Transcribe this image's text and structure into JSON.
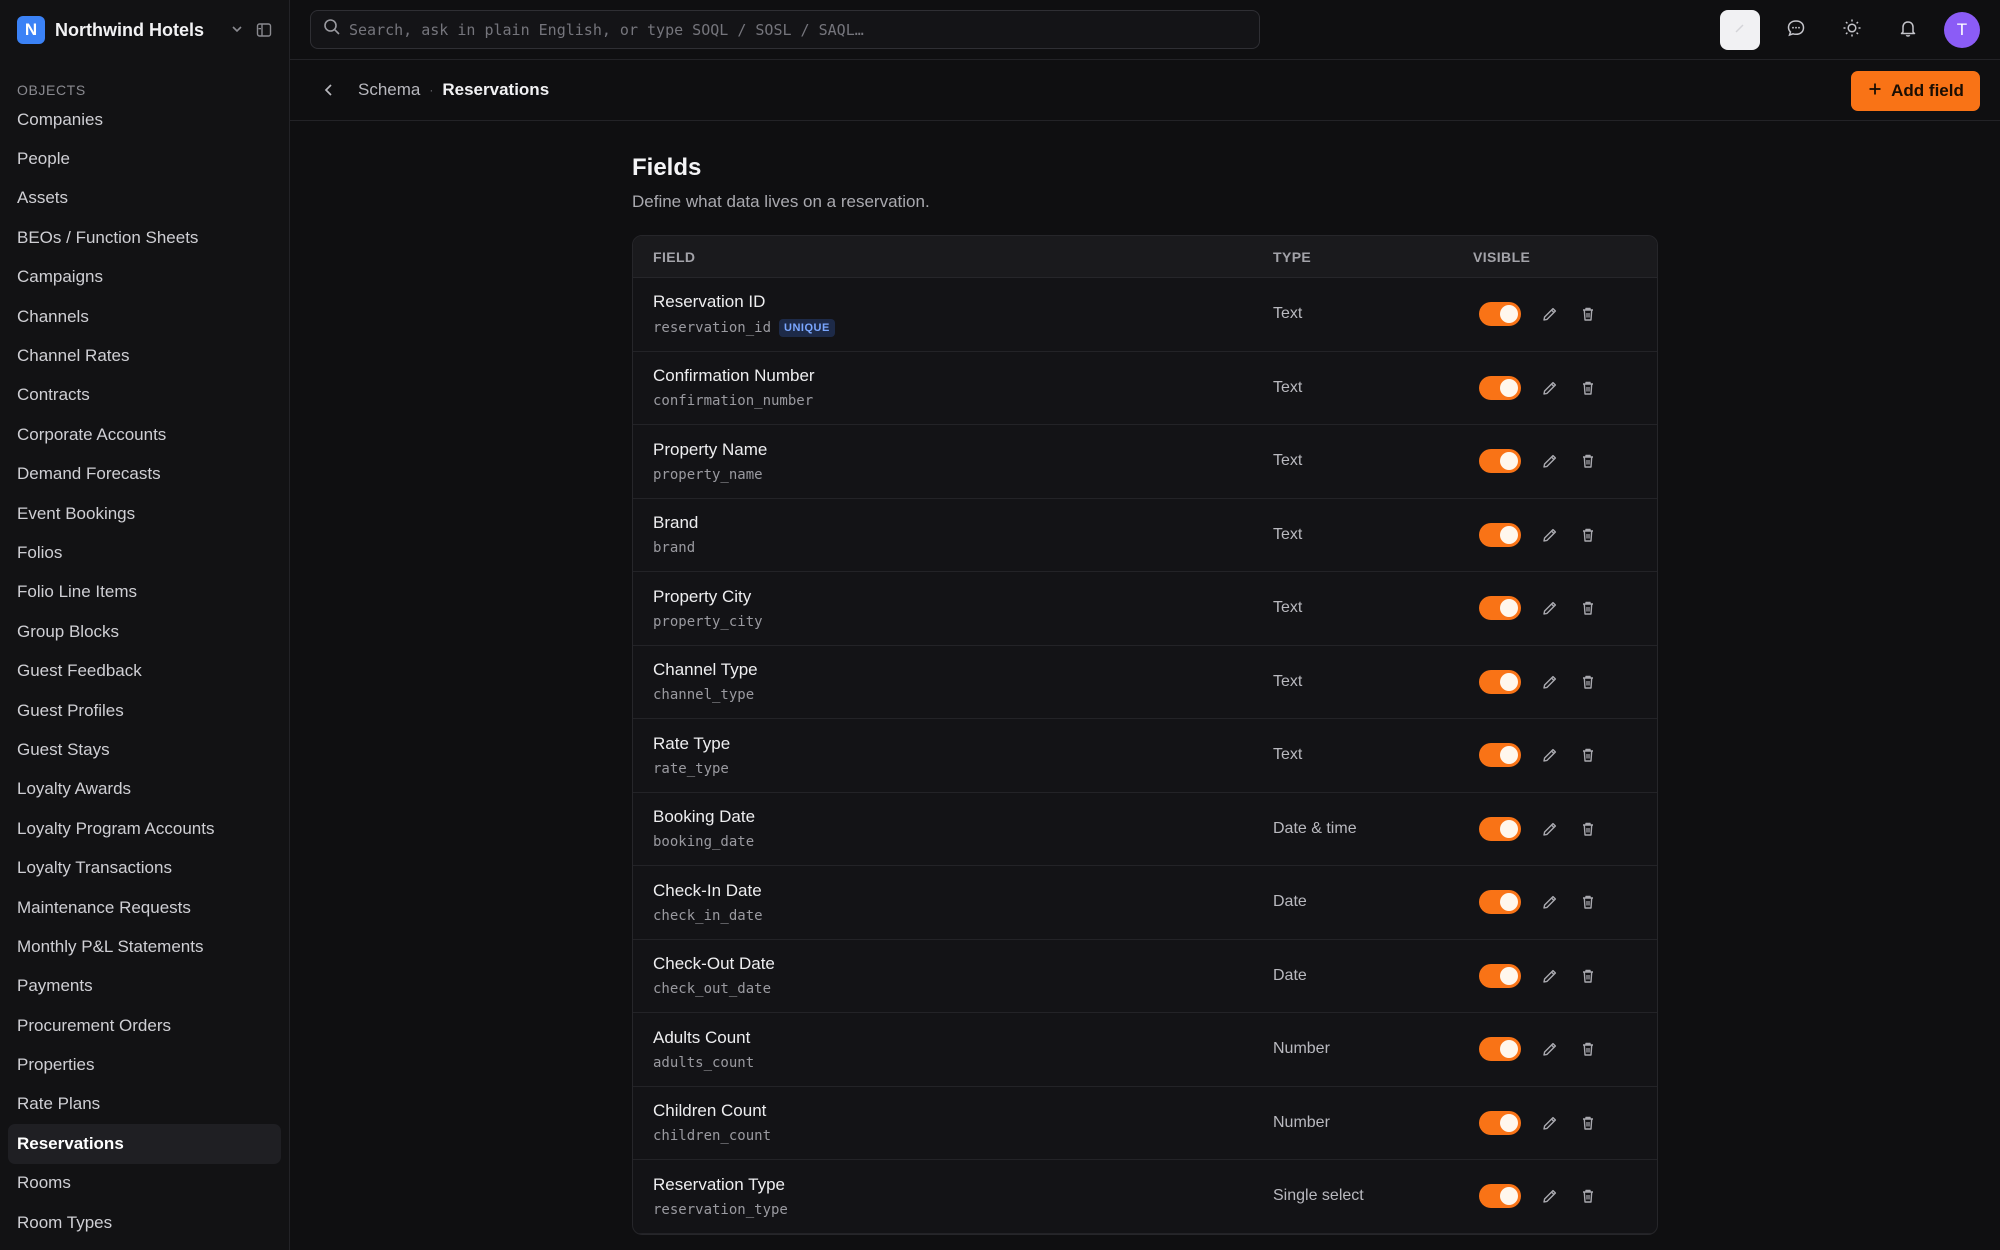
{
  "workspace": {
    "initial": "N",
    "name": "Northwind Hotels"
  },
  "sidebar": {
    "section_label": "OBJECTS",
    "items": [
      "Companies",
      "People",
      "Assets",
      "BEOs / Function Sheets",
      "Campaigns",
      "Channels",
      "Channel Rates",
      "Contracts",
      "Corporate Accounts",
      "Demand Forecasts",
      "Event Bookings",
      "Folios",
      "Folio Line Items",
      "Group Blocks",
      "Guest Feedback",
      "Guest Profiles",
      "Guest Stays",
      "Loyalty Awards",
      "Loyalty Program Accounts",
      "Loyalty Transactions",
      "Maintenance Requests",
      "Monthly P&L Statements",
      "Payments",
      "Procurement Orders",
      "Properties",
      "Rate Plans",
      "Reservations",
      "Rooms",
      "Room Types"
    ],
    "active_item": "Reservations"
  },
  "search": {
    "placeholder": "Search, ask in plain English, or type SOQL / SOSL / SAQL…"
  },
  "user": {
    "initial": "T"
  },
  "breadcrumb": {
    "parent": "Schema",
    "current": "Reservations"
  },
  "add_field_label": "Add field",
  "page": {
    "title": "Fields",
    "subtitle": "Define what data lives on a reservation."
  },
  "table": {
    "headers": {
      "field": "FIELD",
      "type": "TYPE",
      "visible": "VISIBLE"
    },
    "rows": [
      {
        "label": "Reservation ID",
        "key": "reservation_id",
        "badge": "UNIQUE",
        "type": "Text",
        "visible": true
      },
      {
        "label": "Confirmation Number",
        "key": "confirmation_number",
        "badge": "",
        "type": "Text",
        "visible": true
      },
      {
        "label": "Property Name",
        "key": "property_name",
        "badge": "",
        "type": "Text",
        "visible": true
      },
      {
        "label": "Brand",
        "key": "brand",
        "badge": "",
        "type": "Text",
        "visible": true
      },
      {
        "label": "Property City",
        "key": "property_city",
        "badge": "",
        "type": "Text",
        "visible": true
      },
      {
        "label": "Channel Type",
        "key": "channel_type",
        "badge": "",
        "type": "Text",
        "visible": true
      },
      {
        "label": "Rate Type",
        "key": "rate_type",
        "badge": "",
        "type": "Text",
        "visible": true
      },
      {
        "label": "Booking Date",
        "key": "booking_date",
        "badge": "",
        "type": "Date & time",
        "visible": true
      },
      {
        "label": "Check-In Date",
        "key": "check_in_date",
        "badge": "",
        "type": "Date",
        "visible": true
      },
      {
        "label": "Check-Out Date",
        "key": "check_out_date",
        "badge": "",
        "type": "Date",
        "visible": true
      },
      {
        "label": "Adults Count",
        "key": "adults_count",
        "badge": "",
        "type": "Number",
        "visible": true
      },
      {
        "label": "Children Count",
        "key": "children_count",
        "badge": "",
        "type": "Number",
        "visible": true
      },
      {
        "label": "Reservation Type",
        "key": "reservation_type",
        "badge": "",
        "type": "Single select",
        "visible": true
      }
    ]
  },
  "colors": {
    "accent": "#f97316",
    "avatar": "#8b5cf6",
    "workspace_logo": "#3b82f6"
  }
}
